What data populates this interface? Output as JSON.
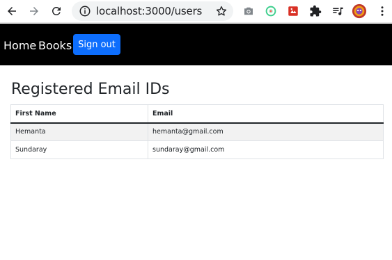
{
  "browser": {
    "url": "localhost:3000/users",
    "icons": [
      "back-arrow-icon",
      "forward-arrow-icon",
      "reload-icon",
      "site-info-icon",
      "bookmark-star-icon",
      "camera-icon",
      "extension-green-circle-icon",
      "extension-red-icon",
      "puzzle-extensions-icon",
      "media-queue-icon",
      "profile-avatar-icon",
      "more-menu-icon"
    ]
  },
  "navbar": {
    "links": [
      "Home",
      "Books"
    ],
    "signout_label": "Sign out",
    "bg_color": "#000000",
    "button_color": "#0d6efd"
  },
  "main": {
    "title": "Registered Email IDs",
    "table": {
      "headers": [
        "First Name",
        "Email"
      ],
      "rows": [
        [
          "Hemanta",
          "hemanta@gmail.com"
        ],
        [
          "Sundaray",
          "sundaray@gmail.com"
        ]
      ]
    }
  }
}
